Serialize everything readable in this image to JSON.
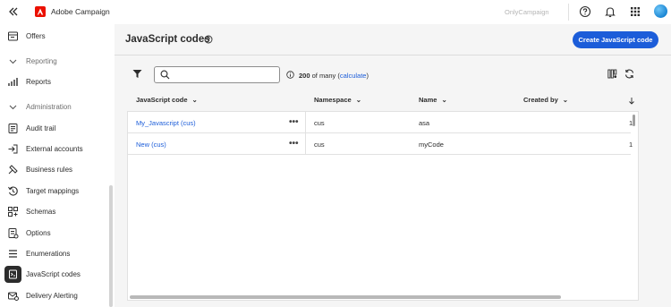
{
  "app": {
    "title": "Adobe Campaign",
    "org": "OnlyCampaign"
  },
  "sidebar": {
    "items": [
      {
        "label": "Offers",
        "icon": "offers-icon",
        "type": "item"
      },
      {
        "label": "Reporting",
        "icon": "chevron-down-icon",
        "type": "section"
      },
      {
        "label": "Reports",
        "icon": "reports-icon",
        "type": "item"
      },
      {
        "label": "Administration",
        "icon": "chevron-down-icon",
        "type": "section"
      },
      {
        "label": "Audit trail",
        "icon": "audit-trail-icon",
        "type": "item"
      },
      {
        "label": "External accounts",
        "icon": "external-accounts-icon",
        "type": "item"
      },
      {
        "label": "Business rules",
        "icon": "business-rules-icon",
        "type": "item"
      },
      {
        "label": "Target mappings",
        "icon": "target-mappings-icon",
        "type": "item"
      },
      {
        "label": "Schemas",
        "icon": "schemas-icon",
        "type": "item"
      },
      {
        "label": "Options",
        "icon": "options-icon",
        "type": "item"
      },
      {
        "label": "Enumerations",
        "icon": "enumerations-icon",
        "type": "item"
      },
      {
        "label": "JavaScript codes",
        "icon": "javascript-codes-icon",
        "type": "item",
        "active": true
      },
      {
        "label": "Delivery Alerting",
        "icon": "delivery-alerting-icon",
        "type": "item"
      }
    ]
  },
  "page": {
    "title": "JavaScript codes",
    "create_label": "Create JavaScript code"
  },
  "toolbar": {
    "search_placeholder": "",
    "count_value": "200",
    "count_suffix": " of many (",
    "count_link": "calculate",
    "count_close": ")"
  },
  "table": {
    "headers": [
      "JavaScript code",
      "Namespace",
      "Name",
      "Created by"
    ],
    "rows": [
      {
        "code": "My_Javascript (cus)",
        "more": "•••",
        "namespace": "cus",
        "name": "asa",
        "trail": "1"
      },
      {
        "code": "New (cus)",
        "more": "•••",
        "namespace": "cus",
        "name": "myCode",
        "trail": "1"
      }
    ]
  },
  "colors": {
    "accent": "#1c5dd9",
    "brand": "#eb1000"
  }
}
